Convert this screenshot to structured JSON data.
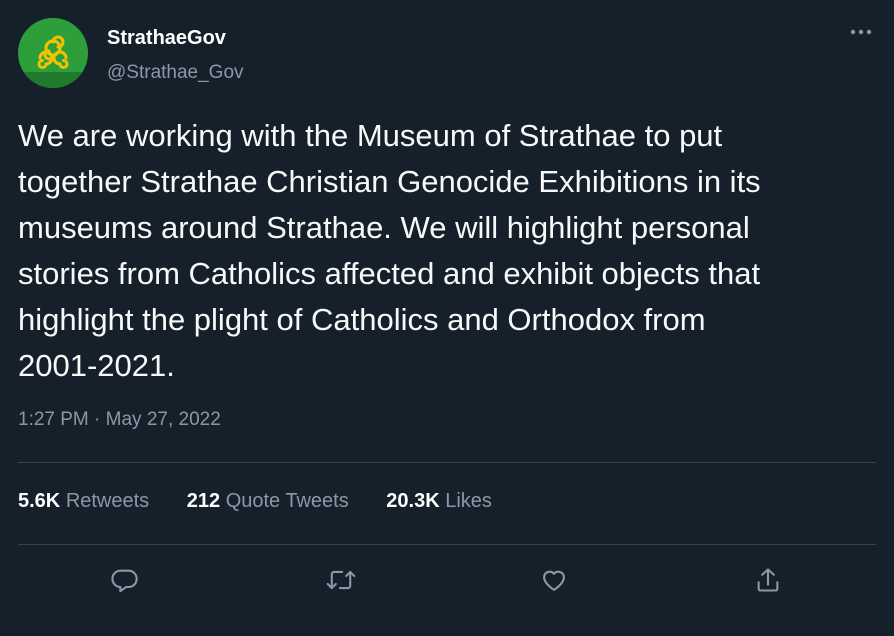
{
  "account": {
    "display_name": "StrathaeGov",
    "handle": "@Strathae_Gov"
  },
  "tweet": {
    "lines": [
      "We are working with the Museum of Strathae to put",
      "together Strathae Christian Genocide Exhibitions in its",
      "museums around Strathae. We will highlight personal",
      "stories from Catholics affected and exhibit objects that",
      "highlight the plight of Catholics and Orthodox from",
      "2001-2021."
    ],
    "timestamp": "1:27 PM · May 27, 2022"
  },
  "stats": {
    "retweets_count": "5.6K",
    "retweets_label": "Retweets",
    "quotes_count": "212",
    "quotes_label": "Quote Tweets",
    "likes_count": "20.3K",
    "likes_label": "Likes"
  },
  "icons": {
    "more": "more-icon",
    "reply": "reply-icon",
    "retweet": "retweet-icon",
    "like": "heart-icon",
    "share": "share-icon"
  },
  "colors": {
    "background": "#15202b",
    "secondary_text": "#8b98a5",
    "divider": "#38444d",
    "avatar_green": "#2e9e3a",
    "avatar_gold": "#f2c300"
  }
}
